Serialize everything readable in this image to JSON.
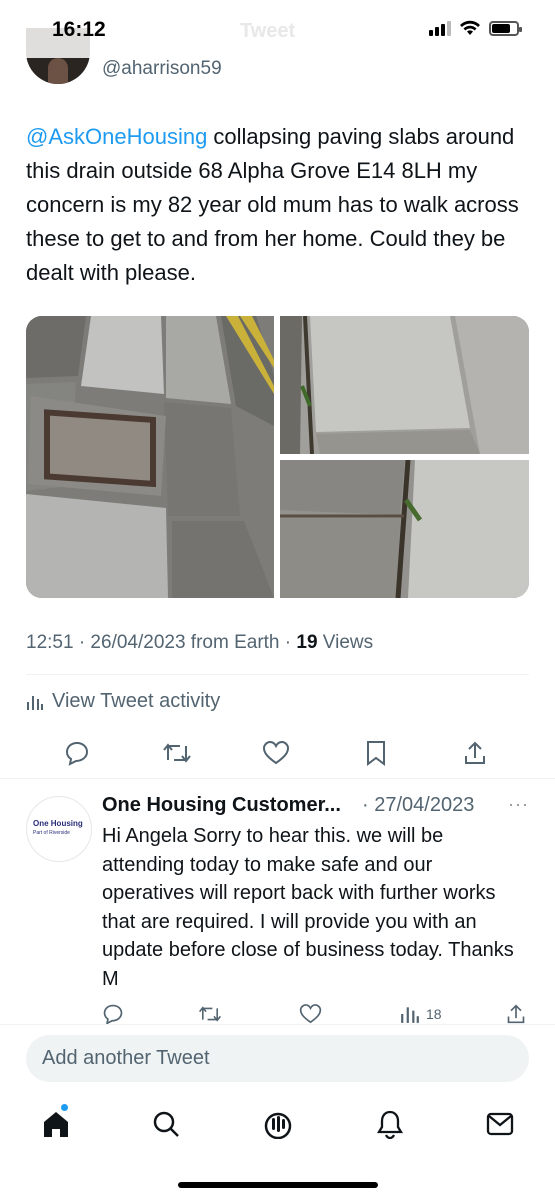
{
  "status_bar": {
    "time": "16:12",
    "battery_level": 0.75
  },
  "header_ghost_title": "Tweet",
  "author": {
    "handle": "@aharrison59"
  },
  "tweet": {
    "mention": "@AskOneHousing",
    "text": " collapsing paving slabs around this drain outside 68 Alpha Grove E14 8LH my concern is my 82 year old mum has to walk across these to get to and from her home. Could they be dealt with please."
  },
  "meta": {
    "timestamp": "12:51 · 26/04/2023 from Earth · ",
    "views_count": "19",
    "views_label": " Views"
  },
  "activity_label": "View Tweet activity",
  "actions": [
    "reply-icon",
    "retweet-icon",
    "like-icon",
    "bookmark-icon",
    "share-icon"
  ],
  "reply": {
    "name": "One Housing Customer...",
    "date": "· 27/04/2023",
    "more": "···",
    "avatar_org": "One Housing",
    "avatar_sub": "Part of Riverside",
    "text": "Hi Angela Sorry to hear this. we will be attending today to make safe and our operatives will report back with further works that are required. I will provide you with an update before close of business today. Thanks M",
    "views": "18"
  },
  "composer": {
    "placeholder": "Add another Tweet"
  },
  "tabs": [
    "home-icon",
    "search-icon",
    "spaces-icon",
    "notifications-icon",
    "messages-icon"
  ],
  "colors": {
    "accent": "#1d9bf0",
    "text": "#0f1419",
    "secondary": "#536471"
  }
}
